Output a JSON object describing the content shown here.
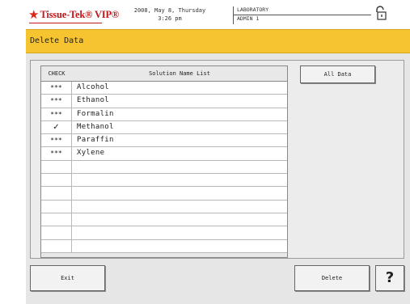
{
  "header": {
    "logo": {
      "text": "Tissue-Tek® VIP®",
      "icon": "star-icon",
      "color": "#c0181c"
    },
    "date": "2008, May 8, Thursday",
    "time": "3:26 pm",
    "department": "LABORATORY",
    "user": "ADMIN 1",
    "lock_icon": "unlock-icon"
  },
  "title": {
    "text": "Delete Data",
    "color": "#f5c430"
  },
  "list": {
    "columns": {
      "check": "CHECK",
      "name": "Solution Name List"
    },
    "rows": [
      {
        "check": "***",
        "name": "Alcohol"
      },
      {
        "check": "***",
        "name": "Ethanol"
      },
      {
        "check": "***",
        "name": "Formalin"
      },
      {
        "check": "✓",
        "name": "Methanol"
      },
      {
        "check": "***",
        "name": "Paraffin"
      },
      {
        "check": "***",
        "name": "Xylene"
      },
      {
        "check": "",
        "name": ""
      },
      {
        "check": "",
        "name": ""
      },
      {
        "check": "",
        "name": ""
      },
      {
        "check": "",
        "name": ""
      },
      {
        "check": "",
        "name": ""
      },
      {
        "check": "",
        "name": ""
      },
      {
        "check": "",
        "name": ""
      }
    ]
  },
  "buttons": {
    "all_data": "All Data",
    "exit": "Exit",
    "delete": "Delete",
    "help": "?"
  }
}
